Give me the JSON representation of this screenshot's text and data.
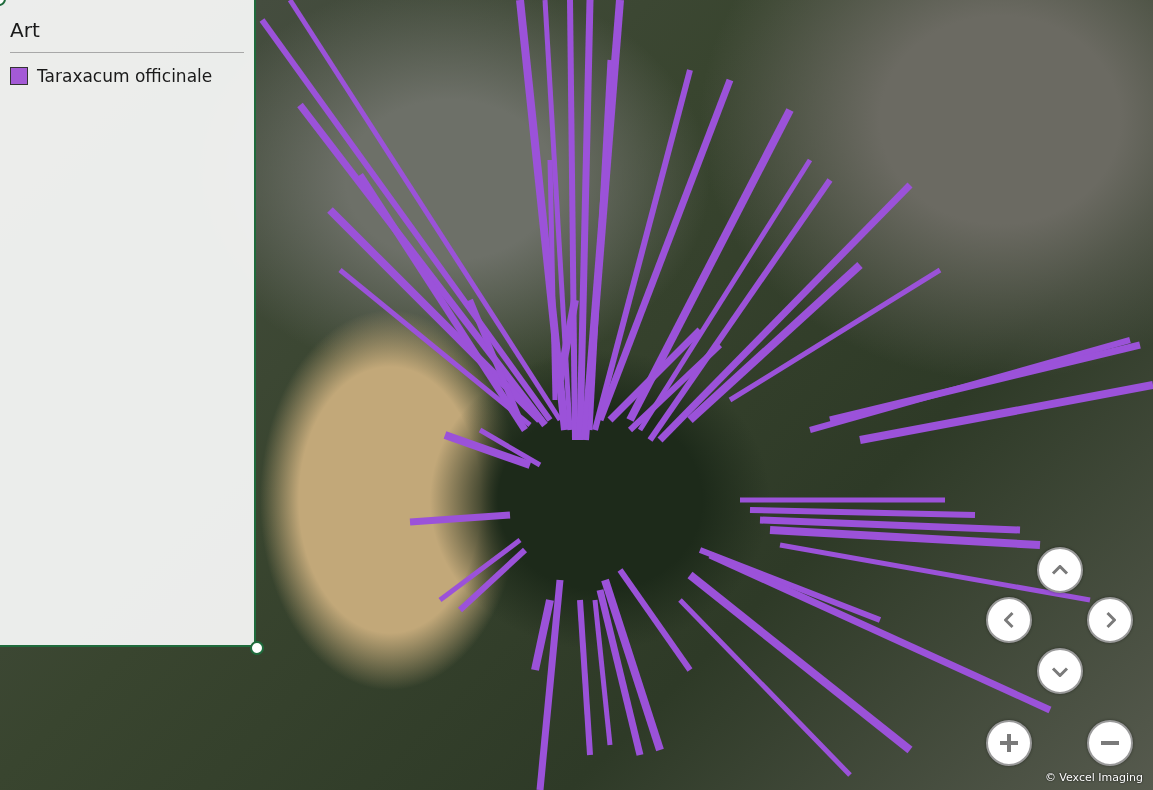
{
  "legend": {
    "title": "Art",
    "items": [
      {
        "label": "Taraxacum officinale",
        "color": "#a45ad6"
      }
    ]
  },
  "attribution": "© Vexcel Imaging"
}
